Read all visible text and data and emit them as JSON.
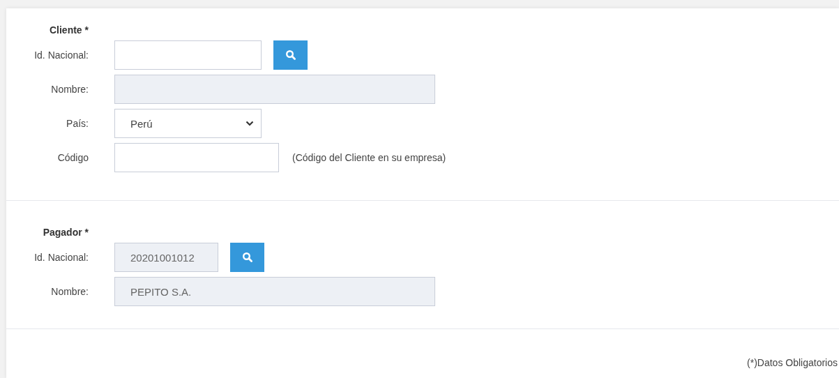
{
  "sections": [
    {
      "title": "Cliente *",
      "fields": [
        {
          "label": "Id. Nacional:",
          "kind": "text",
          "search": true
        },
        {
          "label": "Nombre:",
          "kind": "readonly",
          "search": false
        },
        {
          "label": "País:",
          "kind": "select",
          "value": "Perú",
          "search": false
        },
        {
          "label": "Código",
          "kind": "text",
          "hint": "(Código del Cliente en su empresa)",
          "search": false
        }
      ]
    },
    {
      "title": "Pagador *",
      "fields": [
        {
          "label": "Id. Nacional:",
          "kind": "readonly",
          "value": "20201001012",
          "search": true
        },
        {
          "label": "Nombre:",
          "kind": "readonly",
          "value": "PEPITO S.A.",
          "search": false
        }
      ]
    }
  ],
  "footnote": "(*)Datos Obligatorios"
}
